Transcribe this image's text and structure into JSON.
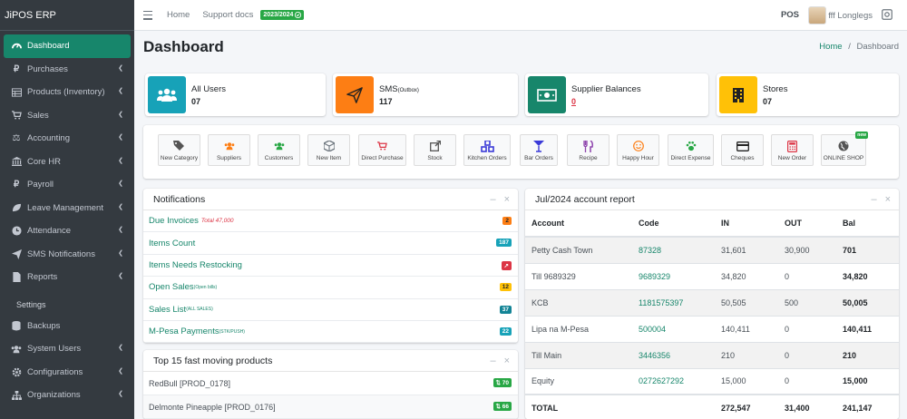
{
  "app": {
    "brand": "JiPOS ERP"
  },
  "sidebar": {
    "items": [
      {
        "label": "Dashboard",
        "icon": "tachometer-icon",
        "active": true,
        "caret": false
      },
      {
        "label": "Purchases",
        "icon": "ruble-icon",
        "caret": true
      },
      {
        "label": "Products (Inventory)",
        "icon": "table-icon",
        "caret": true
      },
      {
        "label": "Sales",
        "icon": "cart-icon",
        "caret": true
      },
      {
        "label": "Accounting",
        "icon": "balance-scale-icon",
        "caret": true
      },
      {
        "label": "Core HR",
        "icon": "bank-icon",
        "caret": true
      },
      {
        "label": "Payroll",
        "icon": "ruble-icon",
        "caret": true
      },
      {
        "label": "Leave Management",
        "icon": "leaf-icon",
        "caret": true
      },
      {
        "label": "Attendance",
        "icon": "clock-icon",
        "caret": true
      },
      {
        "label": "SMS Notifications",
        "icon": "paper-plane-icon",
        "caret": true
      },
      {
        "label": "Reports",
        "icon": "file-icon",
        "caret": true
      }
    ],
    "settings_header": "Settings",
    "settings_items": [
      {
        "label": "Backups",
        "icon": "database-icon",
        "caret": false
      },
      {
        "label": "System Users",
        "icon": "users-icon",
        "caret": true
      },
      {
        "label": "Configurations",
        "icon": "gear-icon",
        "caret": true
      },
      {
        "label": "Organizations",
        "icon": "sitemap-icon",
        "caret": true
      }
    ]
  },
  "topbar": {
    "home": "Home",
    "support": "Support docs",
    "year_badge": "2023/2024",
    "pos": "POS",
    "user": "fff Longlegs"
  },
  "header": {
    "title": "Dashboard",
    "breadcrumb_home": "Home",
    "breadcrumb_sep": "/",
    "breadcrumb_current": "Dashboard"
  },
  "info_boxes": [
    {
      "title": "All Users",
      "small": "",
      "value": "07",
      "color": "#17a2b8",
      "icon": "users-icon"
    },
    {
      "title": "SMS",
      "small": "(Outbox)",
      "value": "117",
      "color": "#fd7e14",
      "icon": "paper-plane-icon"
    },
    {
      "title": "Supplier Balances",
      "small": "",
      "value": "0",
      "color": "#17866b",
      "icon": "money-icon"
    },
    {
      "title": "Stores",
      "small": "",
      "value": "07",
      "color": "#ffc107",
      "icon": "building-icon"
    }
  ],
  "shortcuts": [
    {
      "label": "New Category",
      "icon": "tags-icon",
      "color": "#555"
    },
    {
      "label": "Suppliers",
      "icon": "users-icon",
      "color": "#fd7e14"
    },
    {
      "label": "Customers",
      "icon": "users-icon",
      "color": "#28a745"
    },
    {
      "label": "New Item",
      "icon": "cube-icon",
      "color": "#6c757d"
    },
    {
      "label": "Direct Purchase",
      "icon": "cart-icon",
      "color": "#dc3545"
    },
    {
      "label": "Stock",
      "icon": "external-link-icon",
      "color": "#555"
    },
    {
      "label": "Kitchen Orders",
      "icon": "cubes-icon",
      "color": "#3a3ad8"
    },
    {
      "label": "Bar Orders",
      "icon": "cocktail-icon",
      "color": "#3a3ad8"
    },
    {
      "label": "Recipe",
      "icon": "utensils-icon",
      "color": "#8e44ad"
    },
    {
      "label": "Happy Hour",
      "icon": "smile-icon",
      "color": "#fd7e14"
    },
    {
      "label": "Direct Expense",
      "icon": "paw-icon",
      "color": "#28a745"
    },
    {
      "label": "Cheques",
      "icon": "credit-card-icon",
      "color": "#222"
    },
    {
      "label": "New Order",
      "icon": "calculator-icon",
      "color": "#dc3545"
    },
    {
      "label": "ONLINE SHOP",
      "icon": "globe-icon",
      "color": "#555",
      "badge": "new"
    }
  ],
  "notifications": {
    "title": "Notifications",
    "rows": [
      {
        "label": "Due Invoices",
        "sup": "",
        "extra": "Total 47,000",
        "badge": "2",
        "badge_color": "orange"
      },
      {
        "label": "Items Count",
        "sup": "",
        "extra": "",
        "badge": "187",
        "badge_color": "teal"
      },
      {
        "label": "Items Needs Restocking",
        "sup": "",
        "extra": "",
        "badge": "↗",
        "badge_color": "red"
      },
      {
        "label": "Open Sales",
        "sup": "(Open bills)",
        "extra": "",
        "badge": "12",
        "badge_color": "yellow"
      },
      {
        "label": "Sales List",
        "sup": "(ALL SALES)",
        "extra": "",
        "badge": "37",
        "badge_color": "dark-teal"
      },
      {
        "label": "M-Pesa Payments",
        "sup": "(STK/PUSH)",
        "extra": "",
        "badge": "22",
        "badge_color": "teal"
      }
    ]
  },
  "top_products": {
    "title": "Top 15 fast moving products",
    "rows": [
      {
        "name": "RedBull [PROD_0178]",
        "count": "70"
      },
      {
        "name": "Delmonte Pineapple [PROD_0176]",
        "count": "66"
      }
    ]
  },
  "account_report": {
    "title": "Jul/2024 account report",
    "columns": [
      "Account",
      "Code",
      "IN",
      "OUT",
      "Bal"
    ],
    "rows": [
      {
        "account": "Petty Cash Town",
        "code": "87328",
        "in": "31,601",
        "out": "30,900",
        "bal": "701"
      },
      {
        "account": "Till 9689329",
        "code": "9689329",
        "in": "34,820",
        "out": "0",
        "bal": "34,820"
      },
      {
        "account": "KCB",
        "code": "1181575397",
        "in": "50,505",
        "out": "500",
        "bal": "50,005"
      },
      {
        "account": "Lipa na M-Pesa",
        "code": "500004",
        "in": "140,411",
        "out": "0",
        "bal": "140,411"
      },
      {
        "account": "Till Main",
        "code": "3446356",
        "in": "210",
        "out": "0",
        "bal": "210"
      },
      {
        "account": "Equity",
        "code": "0272627292",
        "in": "15,000",
        "out": "0",
        "bal": "15,000"
      }
    ],
    "total": {
      "label": "TOTAL",
      "in": "272,547",
      "out": "31,400",
      "bal": "241,147"
    }
  },
  "card_tools": {
    "minimize": "–",
    "close": "×"
  }
}
